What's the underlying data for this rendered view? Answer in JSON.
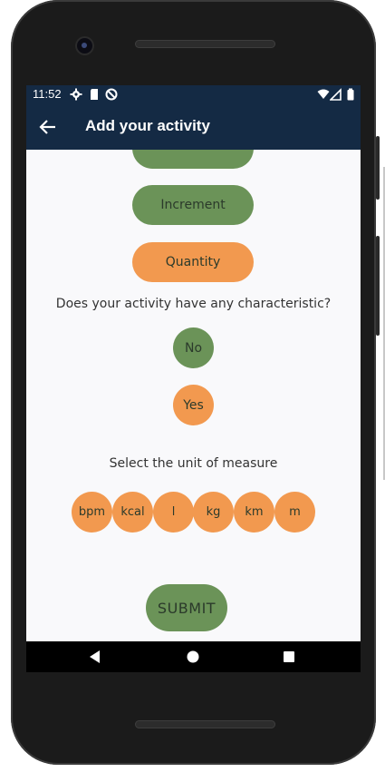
{
  "status_bar": {
    "time": "11:52",
    "left_icons": [
      "gear-icon",
      "sd-card-icon",
      "sync-off-icon"
    ],
    "right_icons": [
      "wifi-icon",
      "cell-signal-icon",
      "battery-icon"
    ]
  },
  "app_bar": {
    "title": "Add your activity",
    "back_icon": "arrow-left-icon"
  },
  "measure_type": {
    "partial_label": "",
    "increment_label": "Increment",
    "quantity_label": "Quantity"
  },
  "characteristic": {
    "question": "Does your activity have any characteristic?",
    "no_label": "No",
    "yes_label": "Yes"
  },
  "units": {
    "prompt": "Select the unit of measure",
    "options": [
      "bpm",
      "kcal",
      "l",
      "kg",
      "km",
      "m"
    ]
  },
  "submit_label": "SUBMIT",
  "nav_bar": {
    "icons": [
      "back-triangle-icon",
      "home-circle-icon",
      "recents-square-icon"
    ]
  },
  "colors": {
    "app_bar": "#142a44",
    "green_button": "#6b9358",
    "orange_button": "#f2994f",
    "background": "#f9f9fb"
  }
}
